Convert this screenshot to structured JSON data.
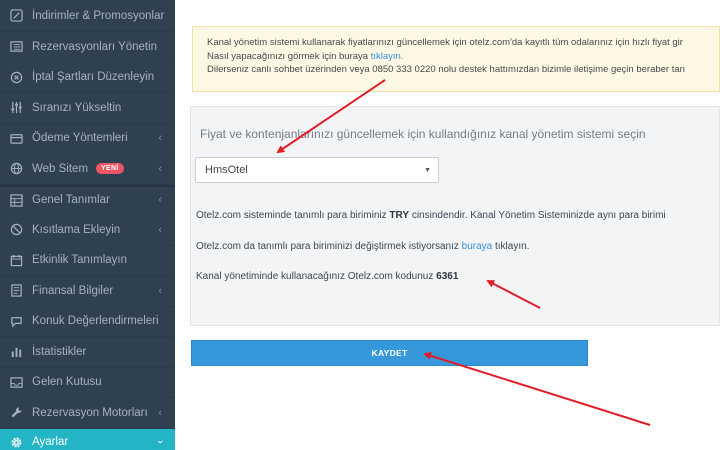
{
  "sidebar": {
    "items": [
      {
        "label": "İndirimler & Promosyonlar",
        "icon": "percent-icon"
      },
      {
        "label": "Rezervasyonları Yönetin",
        "icon": "list-icon"
      },
      {
        "label": "İptal Şartları Düzenleyin",
        "icon": "cancel-circle-icon"
      },
      {
        "label": "Sıranızı Yükseltin",
        "icon": "sliders-icon"
      },
      {
        "label": "Ödeme Yöntemleri",
        "icon": "wallet-icon",
        "chevron": "‹"
      },
      {
        "label": "Web Sitem",
        "icon": "globe-icon",
        "badge": "YENİ",
        "chevron": "‹"
      },
      {
        "label": "Genel Tanımlar",
        "icon": "grid-icon",
        "chevron": "‹"
      },
      {
        "label": "Kısıtlama Ekleyin",
        "icon": "restriction-icon",
        "chevron": "‹"
      },
      {
        "label": "Etkinlik Tanımlayın",
        "icon": "calendar-icon"
      },
      {
        "label": "Finansal Bilgiler",
        "icon": "finance-icon",
        "chevron": "‹"
      },
      {
        "label": "Konuk Değerlendirmeleri",
        "icon": "comment-icon"
      },
      {
        "label": "İstatistikler",
        "icon": "bar-chart-icon"
      },
      {
        "label": "Gelen Kutusu",
        "icon": "inbox-icon"
      },
      {
        "label": "Rezervasyon Motorları",
        "icon": "wrench-icon",
        "chevron": "‹"
      },
      {
        "label": "Ayarlar",
        "icon": "gear-icon",
        "chevron": "›"
      }
    ],
    "active_color": "#23b5c6",
    "badge_color": "#ed5565"
  },
  "notice": {
    "line1": "Kanal yönetim sistemi kullanarak fiyatlarınızı güncellemek için otelz.com'da kayıtlı tüm odalarınız için hızlı fiyat gir",
    "line2_prefix": "Nasıl yapacağınızı görmek için buraya ",
    "line2_link": "tıklayın.",
    "line3": "Dilerseniz canlı sohbet üzerinden veya 0850 333 0220 nolu destek hattımızdan bizimle iletişime geçin beraber tan"
  },
  "panel": {
    "title": "Fiyat ve kontenjanlarınızı güncellemek için kullandığınız kanal yönetim sistemi seçin",
    "select_value": "HmsOtel",
    "currency_prefix": "Otelz.com sisteminde tanımlı para biriminiz ",
    "currency_code": "TRY",
    "currency_suffix": " cinsindendir. Kanal Yönetim Sisteminizde aynı para birimi",
    "change_prefix": "Otelz.com da tanımlı para biriminizi değiştirmek istiyorsanız ",
    "change_link": "buraya",
    "change_suffix": " tıklayın.",
    "code_prefix": "Kanal yönetiminde kullanacağınız Otelz.com kodunuz ",
    "code_value": "6361"
  },
  "save_button": {
    "label": "KAYDET",
    "color": "#3498db"
  },
  "annotation_color": "#e01e28"
}
